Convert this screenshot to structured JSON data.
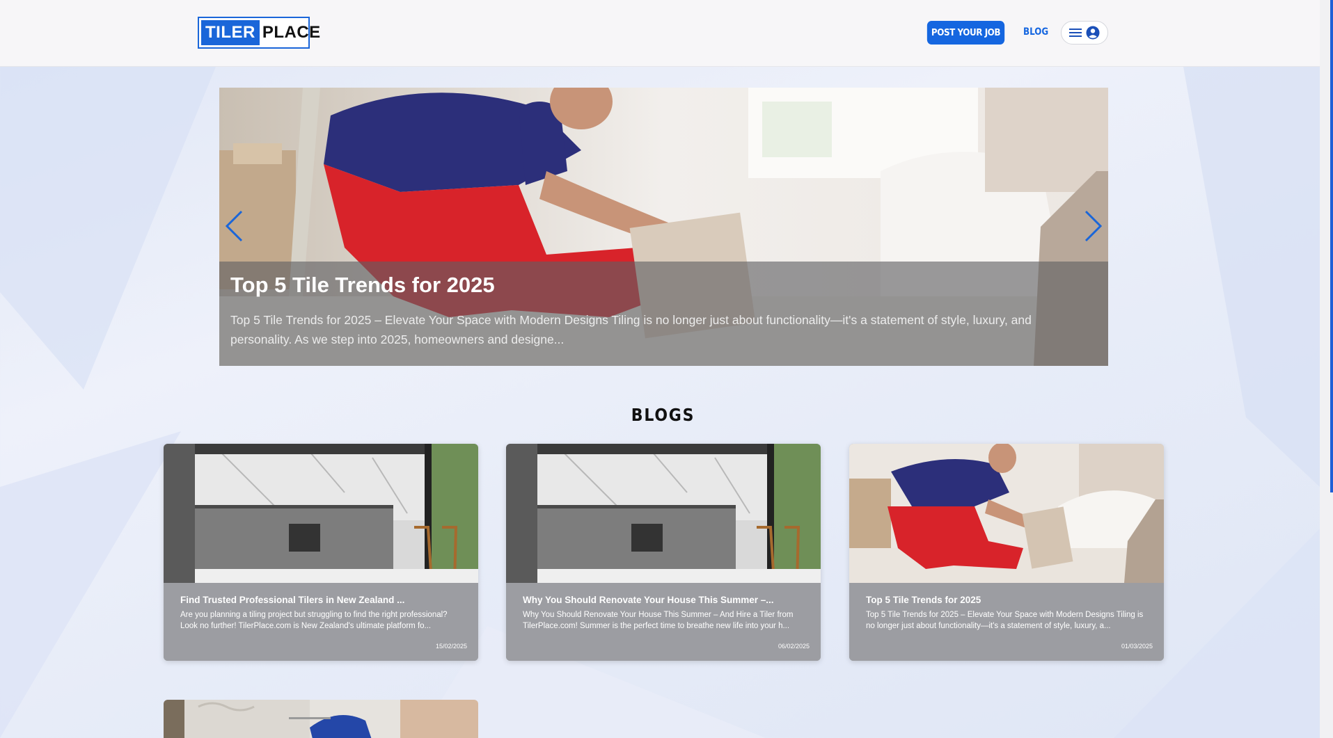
{
  "header": {
    "logo_part1": "TILER",
    "logo_part2": "PLACE",
    "post_job_label": "POST YOUR JOB",
    "blog_label": "BLOG"
  },
  "hero": {
    "title": "Top 5 Tile Trends for 2025",
    "text": "Top 5 Tile Trends for 2025 – Elevate Your Space with Modern Designs Tiling is no longer just about functionality—it's a statement of style, luxury, and personality. As we step into 2025, homeowners and designe..."
  },
  "section": {
    "title": "BLOGS"
  },
  "cards": [
    {
      "title": "Find Trusted Professional Tilers in New Zealand ...",
      "excerpt": "Are you planning a tiling project but struggling to find the right professional? Look no further! TilerPlace.com is New Zealand's ultimate platform fo...",
      "date": "15/02/2025"
    },
    {
      "title": "Why You Should Renovate Your House This Summer –...",
      "excerpt": "Why You Should Renovate Your House This Summer – And Hire a Tiler from TilerPlace.com! Summer is the perfect time to breathe new life into your h...",
      "date": "06/02/2025"
    },
    {
      "title": "Top 5 Tile Trends for 2025",
      "excerpt": "Top 5 Tile Trends for 2025 – Elevate Your Space with Modern Designs Tiling is no longer just about functionality—it's a statement of style, luxury, a...",
      "date": "01/03/2025"
    }
  ],
  "colors": {
    "accent": "#1566e0",
    "card_body": "#9c9da2",
    "worker_shirt": "#2c2f7a",
    "worker_overalls": "#d8232a"
  },
  "icons": {
    "menu": "hamburger-icon",
    "account": "user-circle-icon",
    "prev": "chevron-left-icon",
    "next": "chevron-right-icon"
  }
}
